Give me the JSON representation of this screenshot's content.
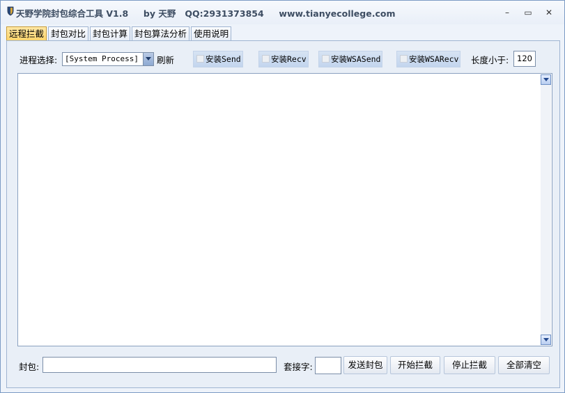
{
  "window": {
    "title": "天野学院封包综合工具 V1.8     by 天野   QQ:2931373854     www.tianyecollege.com",
    "minimize_glyph": "–",
    "maximize_glyph": "▭",
    "close_glyph": "✕",
    "icon": "shield-icon"
  },
  "tabs": [
    {
      "label": "远程拦截",
      "active": true
    },
    {
      "label": "封包对比",
      "active": false
    },
    {
      "label": "封包计算",
      "active": false
    },
    {
      "label": "封包算法分析",
      "active": false
    },
    {
      "label": "使用说明",
      "active": false
    }
  ],
  "toolbar": {
    "process_label": "进程选择:",
    "process_value": "[System Process]",
    "refresh_label": "刷新",
    "install_send": "安装Send",
    "install_recv": "安装Recv",
    "install_wsasend": "安装WSASend",
    "install_wsarecv": "安装WSARecv",
    "length_label": "长度小于:",
    "length_value": "120"
  },
  "bottom": {
    "packet_label": "封包:",
    "packet_value": "",
    "socket_label": "套接字:",
    "socket_value": "",
    "send_button": "发送封包",
    "start_button": "开始拦截",
    "stop_button": "停止拦截",
    "clear_button": "全部清空"
  },
  "colors": {
    "active_tab": "#fcd46a",
    "window_bg": "#e9eff7"
  }
}
